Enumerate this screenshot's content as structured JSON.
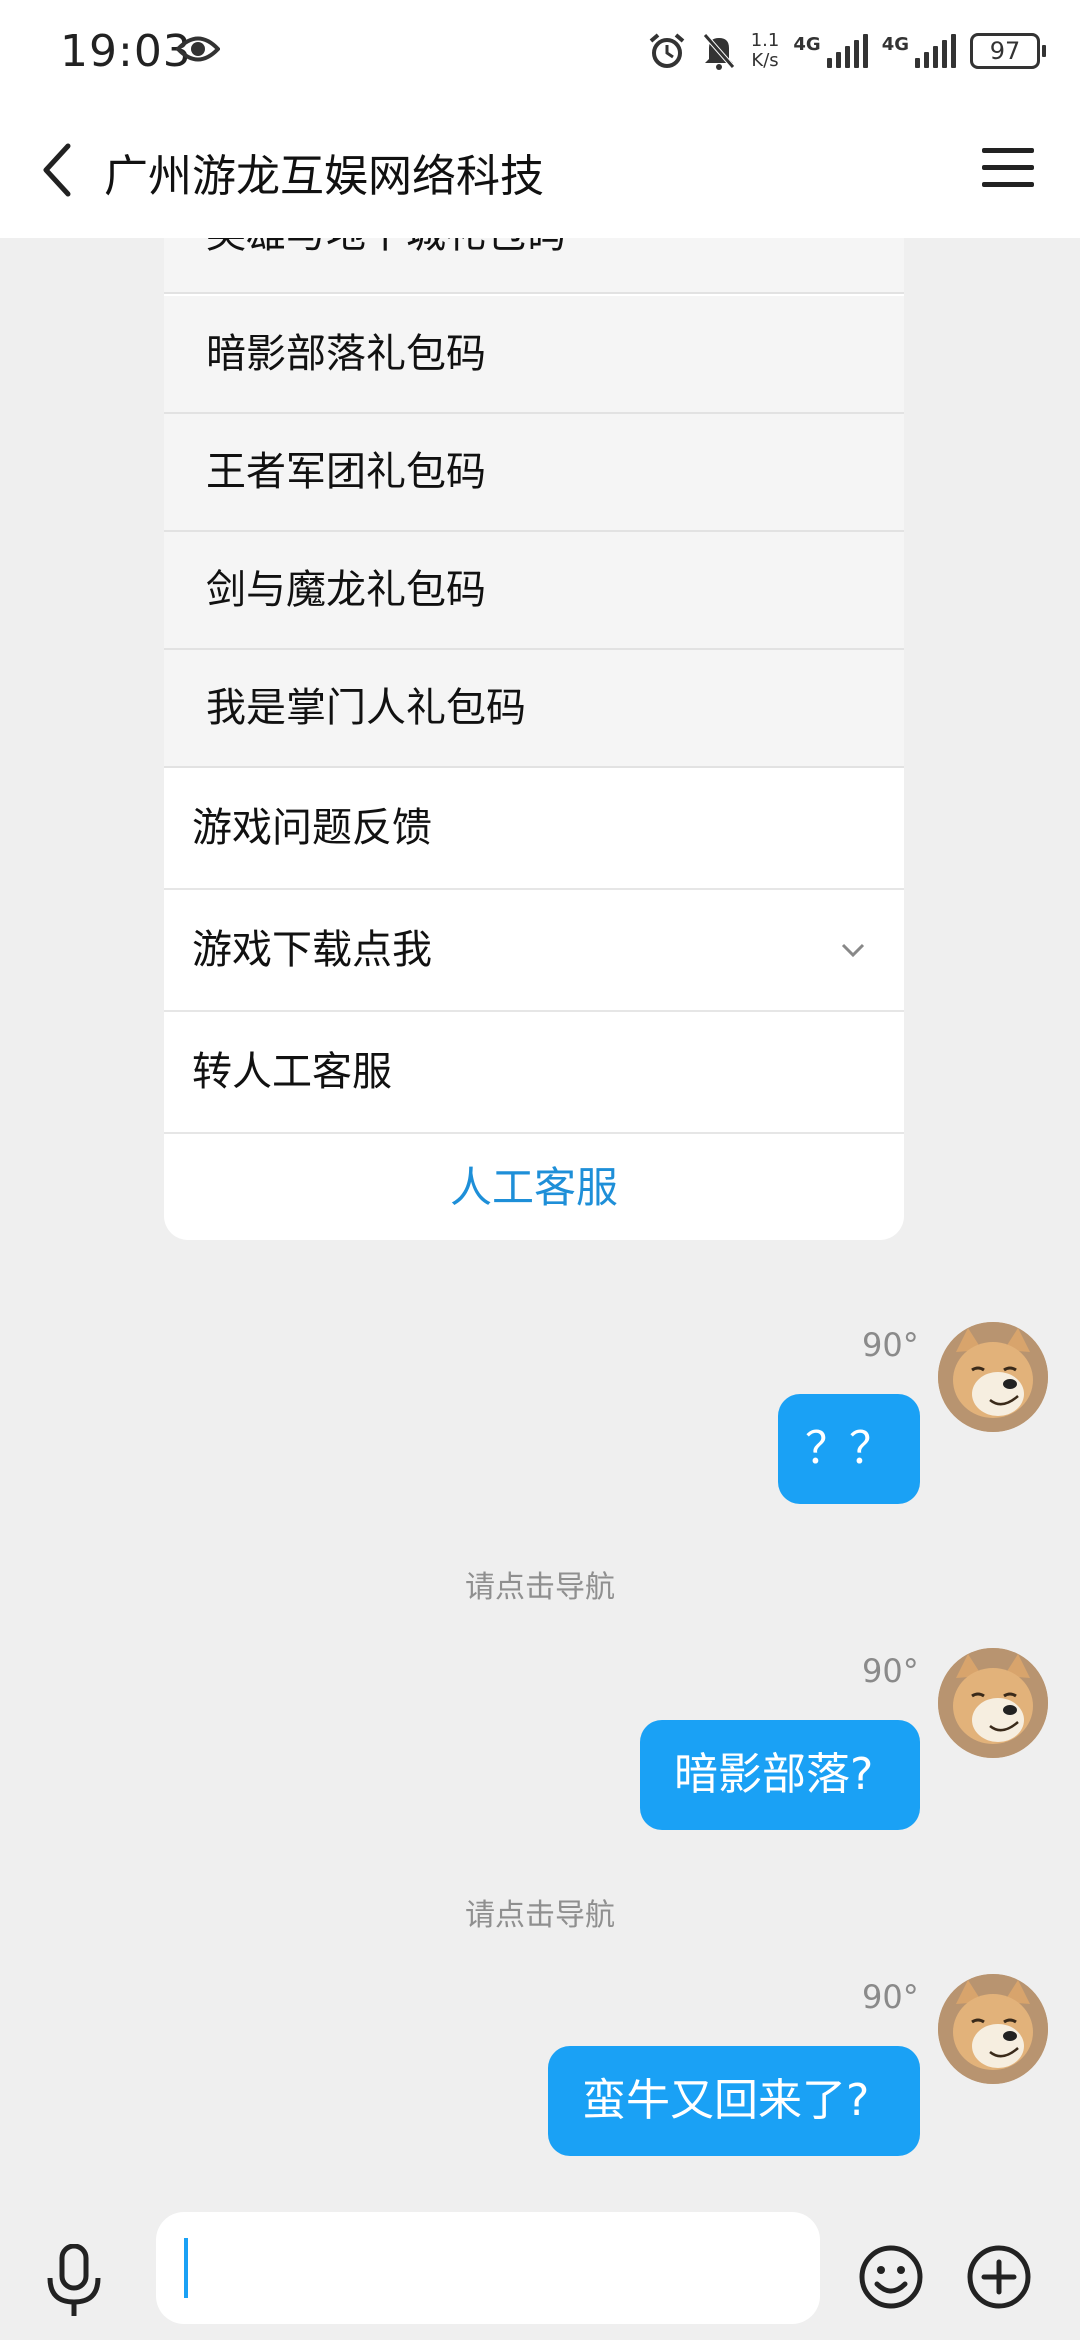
{
  "status_bar": {
    "time": "19:03",
    "net_speed_value": "1.1",
    "net_speed_unit": "K/s",
    "signal1": "4G",
    "signal2": "4G",
    "battery": "97"
  },
  "header": {
    "title": "广州游龙互娱网络科技"
  },
  "menu": {
    "partial_item": "英雄与地下城礼包码",
    "sub_items": [
      "暗影部落礼包码",
      "王者军团礼包码",
      "剑与魔龙礼包码",
      "我是掌门人礼包码"
    ],
    "main_items": [
      "游戏问题反馈",
      "游戏下载点我",
      "转人工客服"
    ],
    "footer_label": "人工客服"
  },
  "messages": [
    {
      "time": "90°",
      "text": "？？"
    },
    {
      "system": "请点击导航"
    },
    {
      "time": "90°",
      "text": "暗影部落?"
    },
    {
      "system": "请点击导航"
    },
    {
      "time": "90°",
      "text": "蛮牛又回来了?"
    }
  ],
  "input": {
    "placeholder": "",
    "value": ""
  },
  "icons": {
    "eye": "eye-icon",
    "back": "back-arrow-icon",
    "menu": "menu-icon",
    "mic": "microphone-icon",
    "emoji": "smiley-icon",
    "plus": "plus-icon"
  },
  "colors": {
    "accent": "#1aa1f5",
    "link": "#1e8fd8"
  }
}
